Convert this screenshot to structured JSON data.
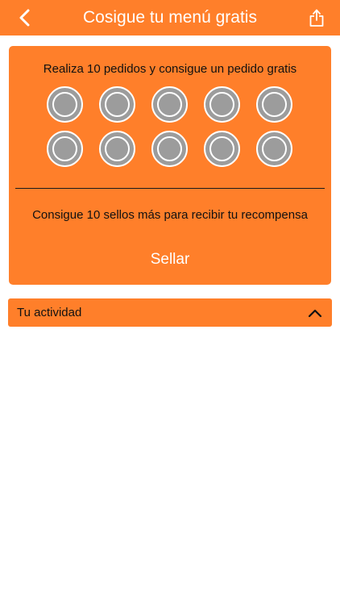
{
  "header": {
    "title": "Cosigue tu menú gratis",
    "back_icon": "chevron-left-icon",
    "share_icon": "share-icon",
    "background_color": "#ff7f2a"
  },
  "loyalty_card": {
    "headline": "Realiza 10 pedidos y consigue un pedido gratis",
    "stamps_total": 10,
    "stamps_collected": 0,
    "status_text": "Consigue 10 sellos más para recibir tu recompensa",
    "stamp_button_label": "Sellar",
    "background_color": "#ff7f2a",
    "empty_stamp_color": "#9c9c9c"
  },
  "activity_section": {
    "label": "Tu actividad",
    "toggle_icon": "chevron-up-icon",
    "expanded": true
  }
}
